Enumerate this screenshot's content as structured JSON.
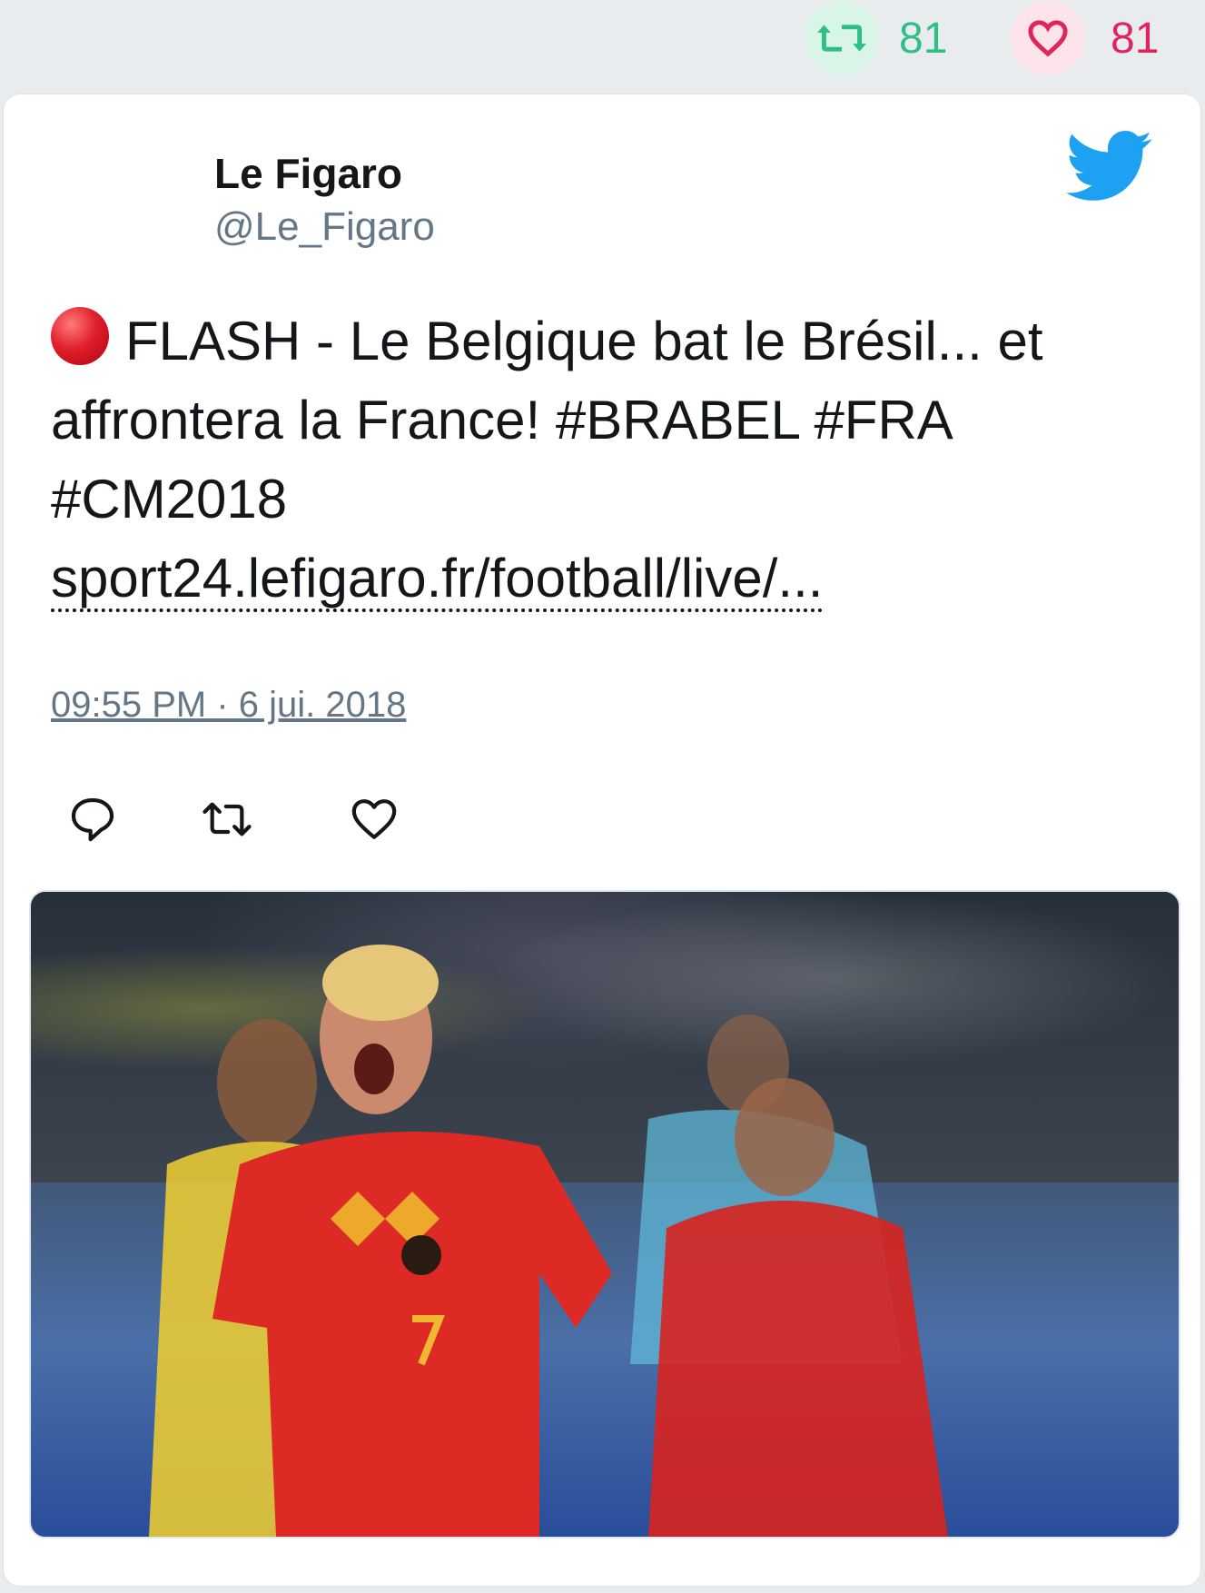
{
  "stats": {
    "retweet_count": "81",
    "like_count": "81"
  },
  "tweet": {
    "author_name": "Le Figaro",
    "author_handle": "@Le_Figaro",
    "text_main": "FLASH - Le Belgique bat le Brésil... et affrontera la France! #BRABEL #FRA #CM2018",
    "link_text": "sport24.lefigaro.fr/football/live/...",
    "timestamp": "09:55 PM · 6 jui. 2018"
  },
  "icons": {
    "logo": "twitter-bird-icon",
    "retweet": "retweet-icon",
    "like": "heart-icon",
    "reply": "reply-icon",
    "flash": "red-circle-emoji"
  },
  "colors": {
    "retweet_green": "#2dbf83",
    "like_red": "#e0245e",
    "twitter_blue": "#1da1f2",
    "handle_gray": "#657786"
  }
}
